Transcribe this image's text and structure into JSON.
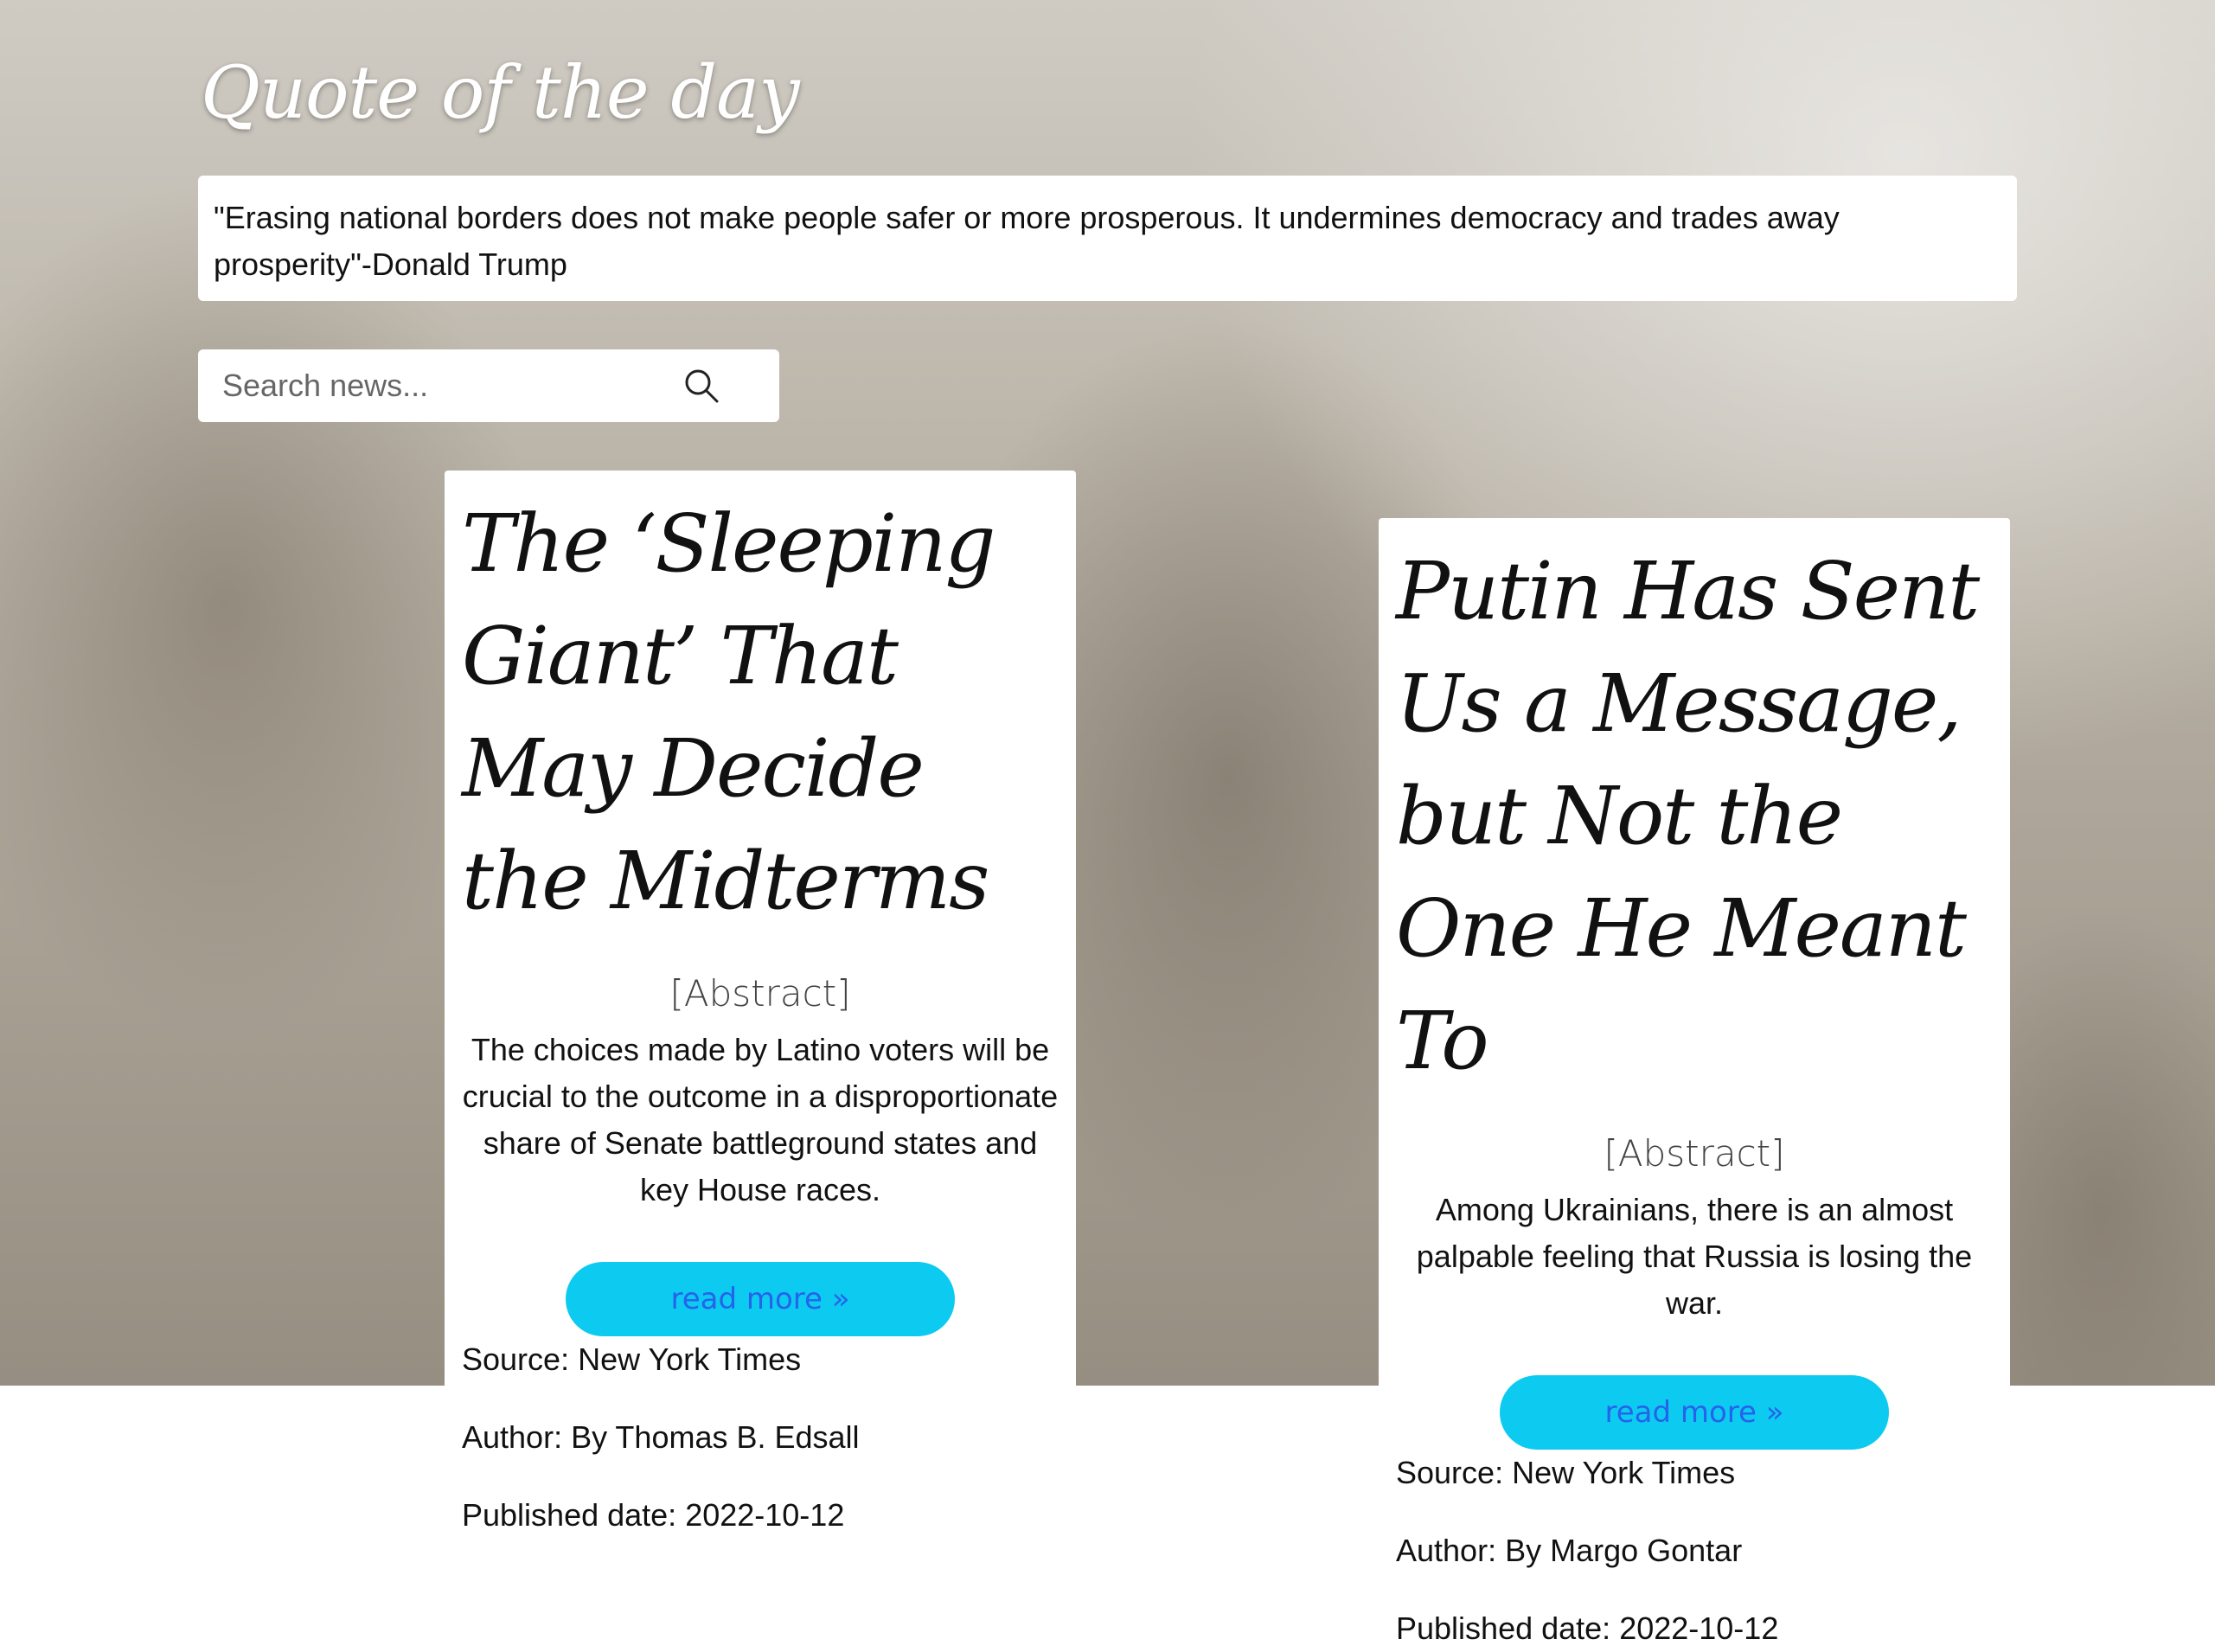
{
  "header": {
    "title": "Quote of the day"
  },
  "quote": {
    "text": "\"Erasing national borders does not make people safer or more prosperous. It undermines democracy and trades away prosperity\"-Donald Trump"
  },
  "search": {
    "placeholder": "Search news..."
  },
  "articles": [
    {
      "title": "The ‘Sleeping Giant’ That May Decide the Midterms",
      "abstract_label": "[Abstract]",
      "abstract": "The choices made by Latino voters will be crucial to the outcome in a disproportionate share of Senate battleground states and key House races.",
      "read_more": "read more »",
      "source": "Source: New York Times",
      "author": "Author: By Thomas B. Edsall",
      "published": "Published date: 2022-10-12"
    },
    {
      "title": "Putin Has Sent Us a Message, but Not the One He Meant To",
      "abstract_label": "[Abstract]",
      "abstract": "Among Ukrainians, there is an almost palpable feeling that Russia is losing the war.",
      "read_more": "read more »",
      "source": "Source: New York Times",
      "author": "Author: By Margo Gontar",
      "published": "Published date: 2022-10-12"
    }
  ],
  "colors": {
    "button": "#0dcaf0",
    "button_text": "#2563eb"
  }
}
